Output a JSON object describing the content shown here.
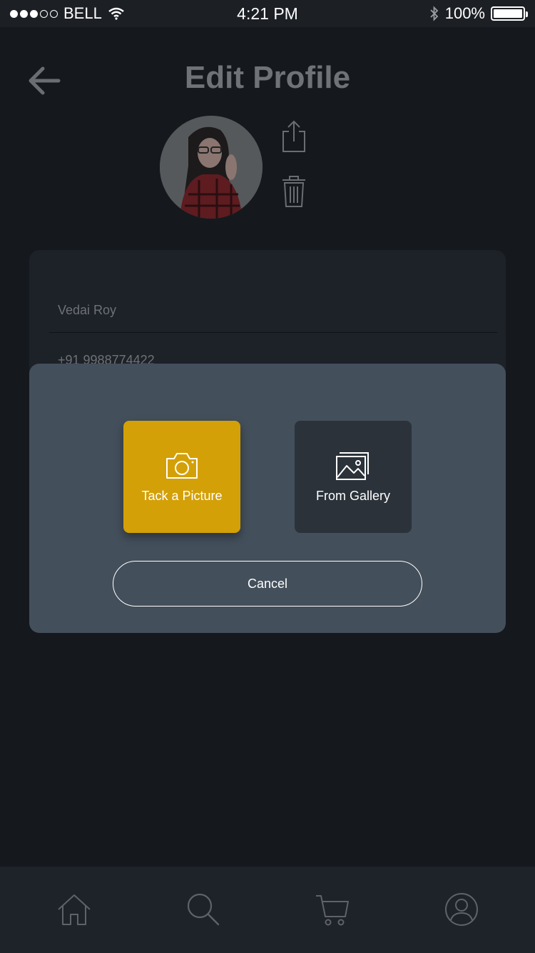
{
  "status_bar": {
    "carrier": "BELL",
    "time": "4:21 PM",
    "battery": "100%",
    "signal_filled": 3,
    "signal_total": 5,
    "icons": [
      "wifi-icon",
      "bluetooth-icon",
      "battery-icon"
    ]
  },
  "header": {
    "title": "Edit Profile",
    "back_icon": "arrow-left-icon",
    "upload_icon": "upload-icon",
    "delete_icon": "trash-icon"
  },
  "form": {
    "name": "Vedai Roy",
    "phone": "+91 9988774422"
  },
  "modal": {
    "options": [
      {
        "label": "Tack a Picture",
        "icon": "camera-icon",
        "color": "#d4a007"
      },
      {
        "label": "From Gallery",
        "icon": "gallery-icon",
        "color": "#2b323a"
      }
    ],
    "cancel_label": "Cancel"
  },
  "bottom_nav": {
    "items": [
      "home-icon",
      "search-icon",
      "cart-icon",
      "profile-icon"
    ]
  },
  "colors": {
    "accent": "#d4a007",
    "modal_bg": "#434f5b",
    "background": "#15191e"
  }
}
